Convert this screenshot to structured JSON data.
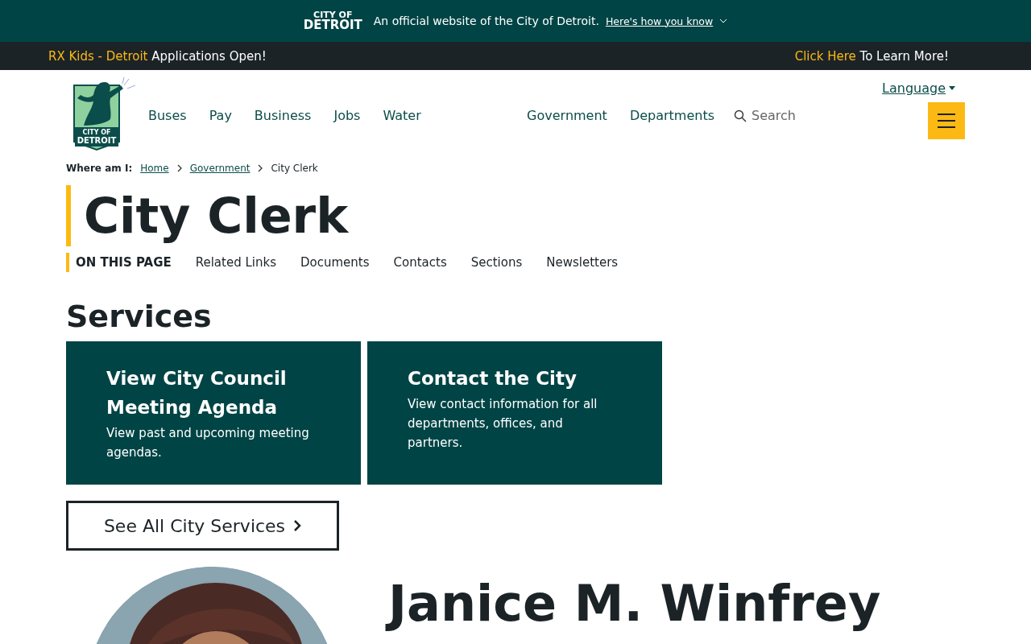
{
  "official_banner": {
    "logo_line_1": "CITY OF",
    "logo_line_2": "DETROIT",
    "text": "An official website of the City of Detroit.",
    "link": "Here's how you know"
  },
  "alert_bar": {
    "left_highlight": "RX Kids - Detroit",
    "left_text": "Applications Open!",
    "right_highlight": "Click Here",
    "right_text": "To Learn More!"
  },
  "header": {
    "logo": {
      "line_1": "CITY OF",
      "line_2": "DETROIT"
    },
    "language": "Language",
    "nav_left": [
      "Buses",
      "Pay",
      "Business",
      "Jobs",
      "Water"
    ],
    "nav_right": [
      "Government",
      "Departments"
    ],
    "search": {
      "placeholder": "Search"
    }
  },
  "breadcrumb": {
    "label": "Where am I:",
    "items": [
      {
        "text": "Home",
        "link": true
      },
      {
        "text": "Government",
        "link": true
      },
      {
        "text": "City Clerk",
        "link": false
      }
    ]
  },
  "page_title": "City Clerk",
  "on_this_page": {
    "label": "ON THIS PAGE",
    "links": [
      "Related Links",
      "Documents",
      "Contacts",
      "Sections",
      "Newsletters"
    ]
  },
  "services": {
    "heading": "Services",
    "cards": [
      {
        "title": "View City Council Meeting Agenda",
        "description": "View past and upcoming meeting agendas."
      },
      {
        "title": "Contact the City",
        "description": "View contact information for all departments, offices, and partners."
      }
    ],
    "see_all": "See All City Services"
  },
  "profile": {
    "kind": "picture",
    "name": "Janice M. Winfrey"
  }
}
